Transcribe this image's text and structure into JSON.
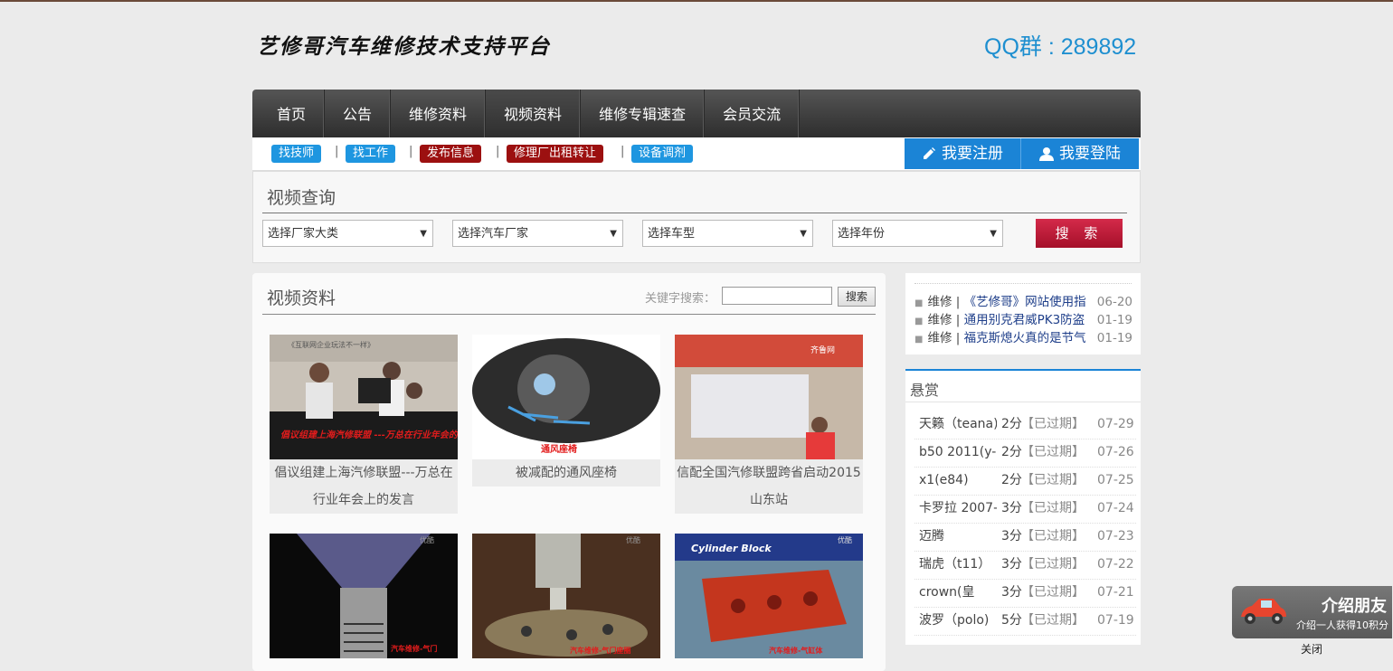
{
  "header": {
    "logo_text": "艺修哥汽车维修技术支持平台",
    "qq_group": "QQ群 : 289892"
  },
  "nav": {
    "items": [
      {
        "label": "首页"
      },
      {
        "label": "公告"
      },
      {
        "label": "维修资料"
      },
      {
        "label": "视频资料"
      },
      {
        "label": "维修专辑速查"
      },
      {
        "label": "会员交流"
      }
    ],
    "active": "视频资料"
  },
  "subnav": {
    "tags": [
      {
        "label": "找技师",
        "color": "#1e96e0"
      },
      {
        "label": "找工作",
        "color": "#1e96e0"
      },
      {
        "label": "发布信息",
        "color": "#9c1010"
      },
      {
        "label": "修理厂出租转让",
        "color": "#9c1010"
      },
      {
        "label": "设备调剂",
        "color": "#1e96e0"
      }
    ],
    "separator": "|",
    "register_label": "我要注册",
    "login_label": "我要登陆",
    "accent": "#1b84d6"
  },
  "video_search": {
    "title": "视频查询",
    "selects": [
      {
        "value": "选择厂家大类"
      },
      {
        "value": "选择汽车厂家"
      },
      {
        "value": "选择车型"
      },
      {
        "value": "选择年份"
      }
    ],
    "button_label": "搜 索"
  },
  "video_list": {
    "title": "视频资料",
    "keyword_label": "关键字搜索：",
    "keyword_value": "",
    "search_button": "搜索",
    "cards": [
      {
        "caption": "倡议组建上海汽修联盟---万总在行业年会上的发言",
        "overlay": "倡议组建上海汽修联盟 ---万总在行业年会的发言",
        "banner": "《互联网企业玩法不一样》"
      },
      {
        "caption": "被减配的通风座椅",
        "overlay": "通风座椅"
      },
      {
        "caption": "信配全国汽修联盟跨省启动2015山东站",
        "overlay": "齐鲁网"
      },
      {
        "caption": "",
        "overlay": "汽车维修-气门",
        "watermark": "优酷"
      },
      {
        "caption": "",
        "overlay": "汽车维修-气门座圈",
        "watermark": "优酷"
      },
      {
        "caption": "",
        "overlay": "汽车维修-气缸体",
        "banner": "Cylinder Block",
        "watermark": "优酷"
      }
    ]
  },
  "news": {
    "items": [
      {
        "category": "维修 |",
        "title": "《艺修哥》网站使用指",
        "date": "06-20"
      },
      {
        "category": "维修 |",
        "title": "通用别克君威PK3防盗",
        "date": "01-19"
      },
      {
        "category": "维修 |",
        "title": "福克斯熄火真的是节气",
        "date": "01-19"
      }
    ]
  },
  "reward": {
    "title": "悬赏",
    "rows": [
      {
        "name": "天籁（teana)",
        "points": "2分",
        "status": "【已过期】",
        "date": "07-29"
      },
      {
        "name": "b50 2011(y-",
        "points": "2分",
        "status": "【已过期】",
        "date": "07-26"
      },
      {
        "name": "x1(e84)",
        "points": "2分",
        "status": "【已过期】",
        "date": "07-25"
      },
      {
        "name": "卡罗拉 2007-",
        "points": "3分",
        "status": "【已过期】",
        "date": "07-24"
      },
      {
        "name": "迈腾",
        "points": "3分",
        "status": "【已过期】",
        "date": "07-23"
      },
      {
        "name": "瑞虎（t11）",
        "points": "3分",
        "status": "【已过期】",
        "date": "07-22"
      },
      {
        "name": "crown(皇",
        "points": "3分",
        "status": "【已过期】",
        "date": "07-21"
      },
      {
        "name": "波罗（polo)",
        "points": "5分",
        "status": "【已过期】",
        "date": "07-19"
      }
    ]
  },
  "invite_widget": {
    "title": "介绍朋友",
    "subtitle": "介绍一人获得10积分",
    "close_label": "关闭"
  }
}
